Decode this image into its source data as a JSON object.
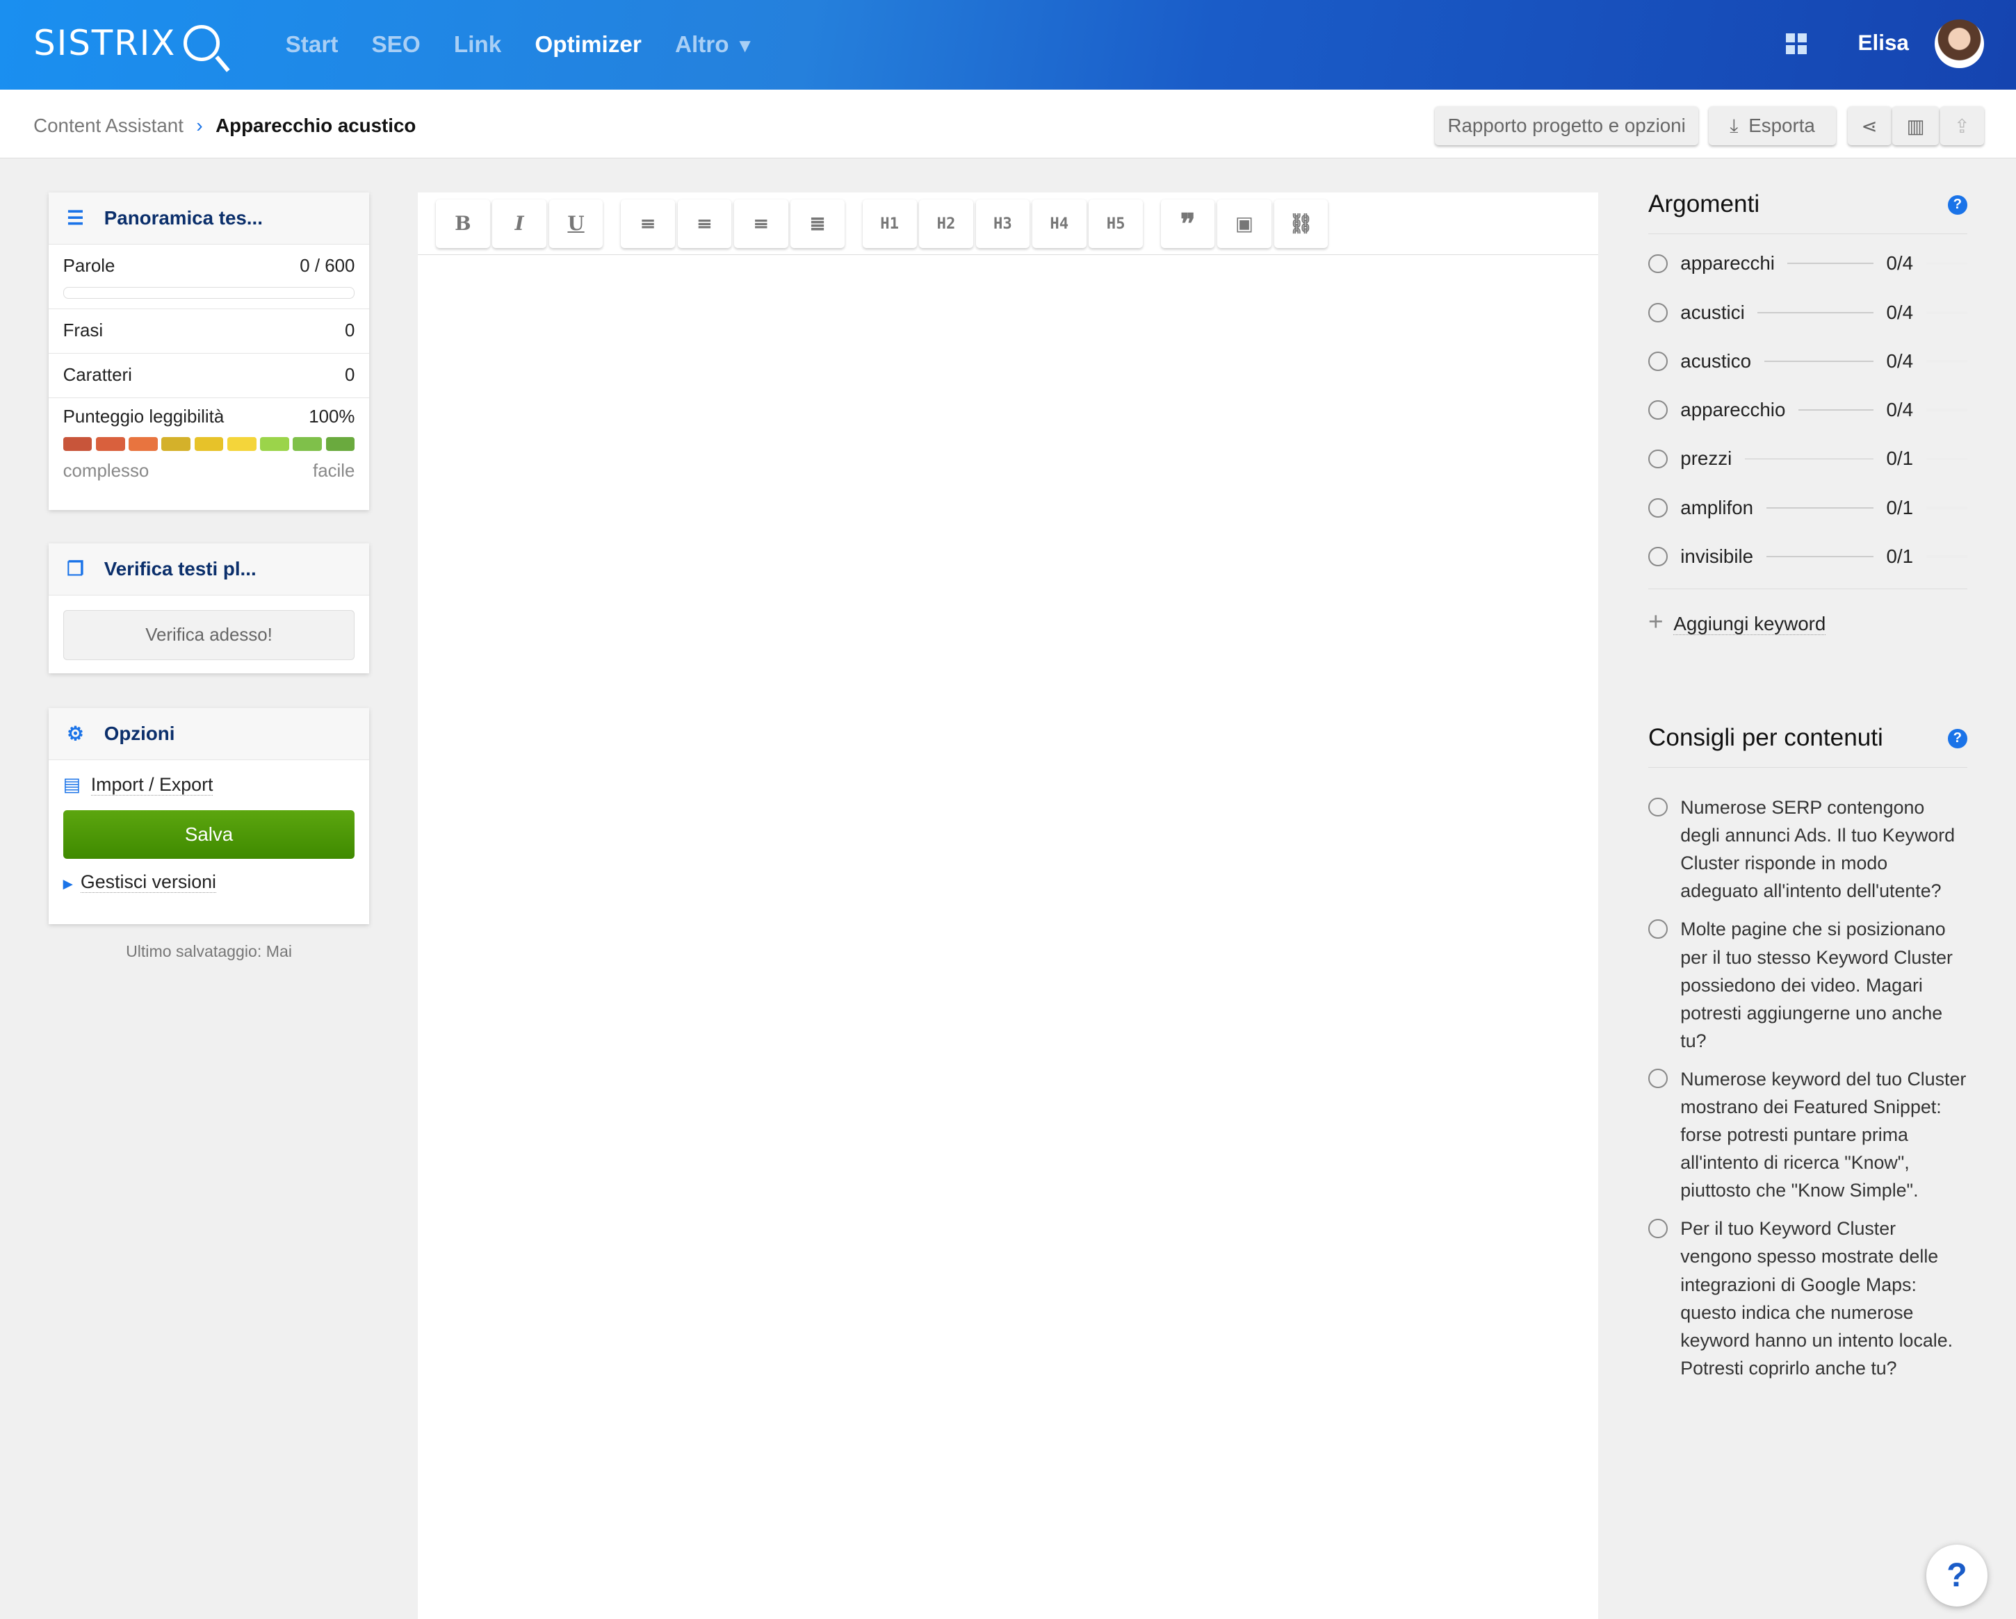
{
  "header": {
    "logo": "SISTRIX",
    "nav": [
      "Start",
      "SEO",
      "Link",
      "Optimizer",
      "Altro"
    ],
    "user": "Elisa"
  },
  "breadcrumb": {
    "parent": "Content Assistant",
    "separator": "›",
    "current": "Apparecchio acustico"
  },
  "toolbar": {
    "report": "Rapporto progetto e opzioni",
    "export": "Esporta"
  },
  "overview": {
    "title": "Panoramica tes...",
    "words_label": "Parole",
    "words_value": "0 / 600",
    "words_progress": 0,
    "sentences_label": "Frasi",
    "sentences_value": "0",
    "chars_label": "Caratteri",
    "chars_value": "0",
    "readability_label": "Punteggio leggibilità",
    "readability_value": "100%",
    "scale_low": "complesso",
    "scale_high": "facile",
    "scale_colors": [
      "#c8553a",
      "#d9603d",
      "#e8743f",
      "#d4b12a",
      "#e7c229",
      "#f4d53a",
      "#9bd44a",
      "#7fc04a",
      "#6aaa3e"
    ]
  },
  "plagiarism": {
    "title": "Verifica testi pl...",
    "button": "Verifica adesso!"
  },
  "options": {
    "title": "Opzioni",
    "import_export": "Import / Export",
    "save": "Salva",
    "versions": "Gestisci versioni",
    "last_save": "Ultimo salvataggio: Mai"
  },
  "editor": {
    "buttons": [
      "B",
      "I",
      "U",
      "H1",
      "H2",
      "H3",
      "H4",
      "H5"
    ]
  },
  "topics": {
    "title": "Argomenti",
    "items": [
      {
        "k": "apparecchi",
        "v": "0/4"
      },
      {
        "k": "acustici",
        "v": "0/4"
      },
      {
        "k": "acustico",
        "v": "0/4"
      },
      {
        "k": "apparecchio",
        "v": "0/4"
      },
      {
        "k": "prezzi",
        "v": "0/1"
      },
      {
        "k": "amplifon",
        "v": "0/1"
      },
      {
        "k": "invisibile",
        "v": "0/1"
      }
    ],
    "add": "Aggiungi keyword"
  },
  "tips": {
    "title": "Consigli per contenuti",
    "items": [
      "Numerose SERP contengono degli annunci Ads. Il tuo Keyword Cluster risponde in modo adeguato all'intento dell'utente?",
      "Molte pagine che si posizionano per il tuo stesso Keyword Cluster possiedono dei video. Magari potresti aggiungerne uno anche tu?",
      "Numerose keyword del tuo Cluster mostrano dei Featured Snippet: forse potresti puntare prima all'intento di ricerca \"Know\", piuttosto che \"Know Simple\".",
      "Per il tuo Keyword Cluster vengono spesso mostrate delle integrazioni di Google Maps: questo indica che numerose keyword hanno un intento locale. Potresti coprirlo anche tu?"
    ]
  },
  "help": "?"
}
